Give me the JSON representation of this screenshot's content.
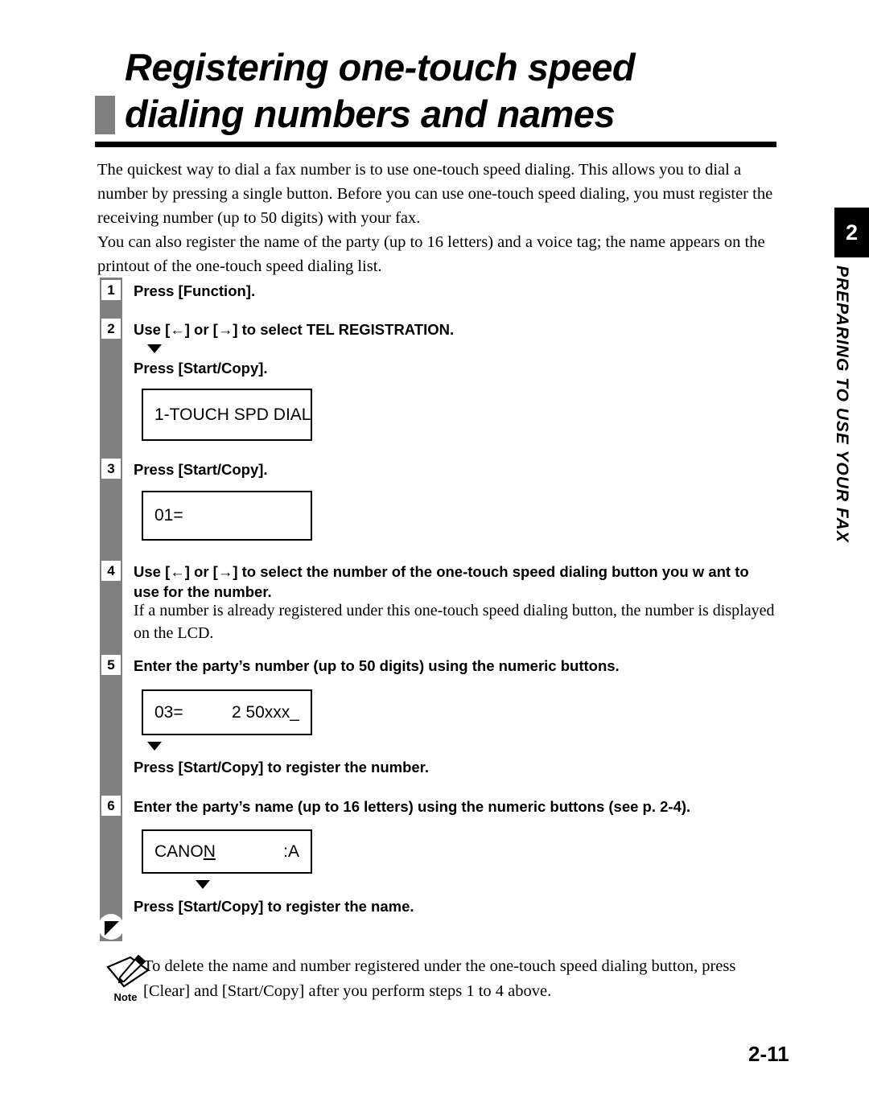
{
  "title": {
    "line1": "Registering one-touch speed",
    "line2": "dialing numbers and names"
  },
  "intro": {
    "paragraph1": "The quickest way to dial a fax number is to use one-touch speed dialing. This allows you to dial a number by pressing a single button. Before you can use one-touch speed dialing, you must register the receiving number (up to 50 digits) with your fax.",
    "paragraph2": "You can also register the name of the party (up to 16 letters) and a voice tag; the name appears on the printout of the one-touch speed dialing list."
  },
  "steps": [
    {
      "number": "1",
      "text": "Press [Function]."
    },
    {
      "number": "2",
      "text": "Use [←] or [→] to select TEL REGISTRATION."
    },
    {
      "number": "3",
      "text": "Press [Start/Copy]."
    },
    {
      "number": "4",
      "text": "Use [←] or [→] to select the number of the one-touch speed dialing button you w ant to use for the number."
    },
    {
      "number": "5",
      "text": "Enter the party’s number (up to 50 digits) using the numeric buttons."
    },
    {
      "number": "6",
      "text": "Enter the party’s name (up to 16 letters) using the numeric buttons (see p. 2-4)."
    }
  ],
  "sub_instructions": {
    "after_step2": "Press [Start/Copy].",
    "after_step5_lcd": "Press [Start/Copy] to register the number.",
    "after_step6_lcd": "Press [Start/Copy] to register the name."
  },
  "step4_note": "If a number is already registered under this one-touch speed dialing button, the number is displayed on the LCD.",
  "lcd_displays": [
    {
      "id": "lcd-1touch",
      "left": "1-TOUCH SPD DIAL",
      "right": ""
    },
    {
      "id": "lcd-01",
      "left": "01=",
      "right": ""
    },
    {
      "id": "lcd-03",
      "left": "03=",
      "right": "2 50xxx_"
    },
    {
      "id": "lcd-canon",
      "left_prefix": "CANO",
      "left_cursor": "N",
      "right": ":A"
    }
  ],
  "side_tab": {
    "chapter_number": "2",
    "chapter_title": "PREPARING TO USE YOUR FAX"
  },
  "note": {
    "label": "Note",
    "text": "To delete the name and number registered under the one-touch speed dialing button, press [Clear] and [Start/Copy] after you perform steps 1 to 4 above."
  },
  "page_number": "2-11",
  "colors": {
    "rail_gray": "#808080",
    "title_marker_gray": "#808080",
    "rule_black": "#000000",
    "tab_black": "#000000"
  }
}
